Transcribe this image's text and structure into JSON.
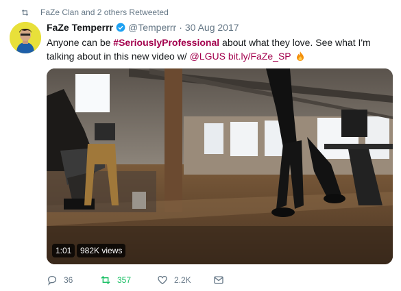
{
  "retweet_context": {
    "text": "FaZe Clan and 2 others Retweeted"
  },
  "author": {
    "name": "FaZe Temperrr",
    "handle": "@Temperrr",
    "separator": "·",
    "date": "30 Aug 2017",
    "verified": true
  },
  "tweet": {
    "text_1": "Anyone can be ",
    "hashtag": "#SeriouslyProfessional",
    "text_2": " about what they love. See what I'm talking about in this new video w/ ",
    "mention": "@LGUS",
    "text_3": " ",
    "link": "bit.ly/FaZe_SP",
    "emoji": "fire-icon"
  },
  "video": {
    "duration": "1:01",
    "views": "982K views"
  },
  "actions": {
    "reply_count": "36",
    "retweet_count": "357",
    "like_count": "2.2K"
  },
  "colors": {
    "accent": "#a3004d",
    "retweet_green": "#17bf63",
    "muted": "#657786"
  }
}
